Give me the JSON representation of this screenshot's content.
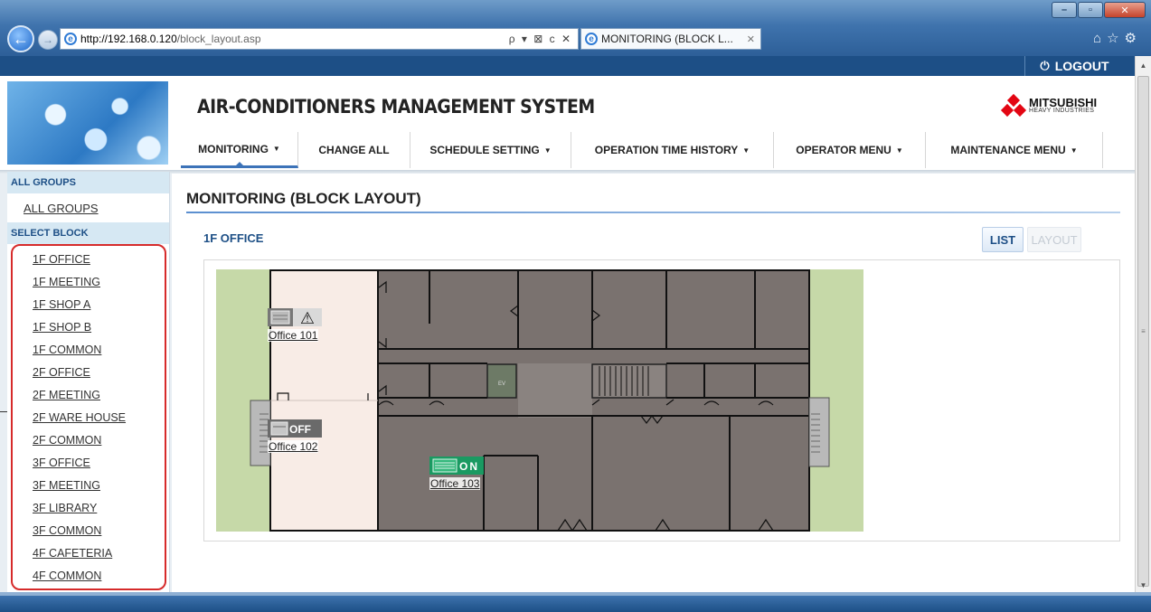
{
  "browser": {
    "url_host": "http://192.168.0.120",
    "url_path": "/block_layout.asp",
    "tab_title": "MONITORING (BLOCK L...",
    "address_tools": "ρ ▾ ⊠ c ✕",
    "right_icons": "⌂☆⚙",
    "min": "–",
    "max": "▫",
    "close": "✕"
  },
  "header": {
    "logout": "LOGOUT",
    "title": "AIR-CONDITIONERS MANAGEMENT SYSTEM",
    "brand_name": "MITSUBISHI",
    "brand_sub": "HEAVY INDUSTRIES"
  },
  "nav": {
    "items": [
      {
        "label": "MONITORING",
        "dropdown": "▼"
      },
      {
        "label": "CHANGE ALL",
        "dropdown": ""
      },
      {
        "label": "SCHEDULE SETTING",
        "dropdown": "▼"
      },
      {
        "label": "OPERATION TIME HISTORY",
        "dropdown": "▼"
      },
      {
        "label": "OPERATOR MENU",
        "dropdown": "▼"
      },
      {
        "label": "MAINTENANCE MENU",
        "dropdown": "▼"
      }
    ]
  },
  "sidebar": {
    "all_groups_header": "ALL GROUPS",
    "all_groups_link": "ALL GROUPS",
    "select_block_header": "SELECT BLOCK",
    "blocks": [
      "1F OFFICE",
      "1F MEETING",
      "1F SHOP A",
      "1F SHOP B",
      "1F COMMON",
      "2F OFFICE",
      "2F MEETING",
      "2F WARE HOUSE",
      "2F COMMON",
      "3F OFFICE",
      "3F MEETING",
      "3F LIBRARY",
      "3F COMMON",
      "4F CAFETERIA",
      "4F COMMON"
    ]
  },
  "main": {
    "page_title": "MONITORING (BLOCK LAYOUT)",
    "block_name": "1F OFFICE",
    "list_button": "LIST",
    "layout_button": "LAYOUT",
    "ev_label": "EV",
    "units": [
      {
        "label": "Office 101",
        "status": "warning",
        "status_text": "⚠"
      },
      {
        "label": "Office 102",
        "status": "off",
        "status_text": "OFF"
      },
      {
        "label": "Office 103",
        "status": "on",
        "status_text": "ON"
      }
    ]
  },
  "colors": {
    "accent": "#1d4f86",
    "highlight_border": "#d62b2b",
    "unit_on": "#1a9a62",
    "unit_off": "#6a6a6a",
    "floor_room": "#7a726f",
    "floor_office": "#f8ece6",
    "outside": "#c6d9a8"
  }
}
